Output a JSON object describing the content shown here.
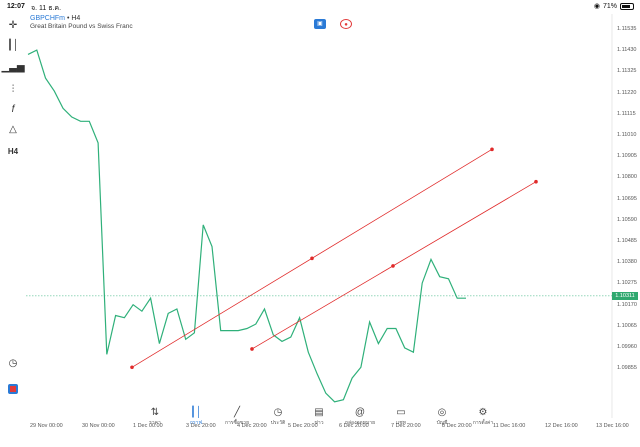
{
  "status": {
    "time": "12:07",
    "date": "จ. 11 ธ.ค.",
    "battery": "71%"
  },
  "chart": {
    "symbol": "GBPCHFm",
    "timeframe": "H4",
    "description": "Great Britain Pound vs Swiss Franc",
    "current_price": "1.10311",
    "line_color": "#2fb07a",
    "trendline_color": "#e02a2a"
  },
  "price_axis": [
    "1.11535",
    "1.11430",
    "1.11325",
    "1.11220",
    "1.11115",
    "1.11010",
    "1.10905",
    "1.10800",
    "1.10695",
    "1.10590",
    "1.10485",
    "1.10380",
    "1.10275",
    "1.10170",
    "1.10065",
    "1.09960",
    "1.09855"
  ],
  "time_axis": [
    "29 Nov 00:00",
    "30 Nov 00:00",
    "1 Dec 00:00",
    "3 Dec 20:00",
    "4 Dec 20:00",
    "5 Dec 20:00",
    "6 Dec 20:00",
    "7 Dec 20:00",
    "8 Dec 20:00",
    "11 Dec 16:00",
    "12 Dec 16:00",
    "13 Dec 16:00"
  ],
  "nav": [
    {
      "label": "ราคา",
      "icon": "quotes-icon"
    },
    {
      "label": "กราฟ",
      "icon": "chart-icon"
    },
    {
      "label": "การซื้อขาย",
      "icon": "trade-icon"
    },
    {
      "label": "ประวัติ",
      "icon": "history-icon"
    },
    {
      "label": "ข่าว",
      "icon": "news-icon"
    },
    {
      "label": "กล่องจดหมาย",
      "icon": "mailbox-icon"
    },
    {
      "label": "แชท",
      "icon": "chat-icon"
    },
    {
      "label": "บัญชี",
      "icon": "account-icon"
    },
    {
      "label": "การตั้งค่า",
      "icon": "settings-icon"
    }
  ],
  "chart_data": {
    "type": "line",
    "title": "",
    "series": [
      {
        "name": "",
        "values": [
          1.1143,
          1.1145,
          1.1132,
          1.1126,
          1.1118,
          1.1114,
          1.1112,
          1.1112,
          1.1102,
          1.1004,
          1.1022,
          1.1021,
          1.1027,
          1.1024,
          1.103,
          1.1009,
          1.1023,
          1.1025,
          1.1011,
          1.1014,
          1.1064,
          1.1054,
          1.1015,
          1.1015,
          1.1015,
          1.1016,
          1.1018,
          1.1025,
          1.1013,
          1.101,
          1.1012,
          1.1021,
          1.1005,
          1.0995,
          1.0986,
          1.0982,
          1.0983,
          1.0993,
          1.0998,
          1.1019,
          1.1009,
          1.1016,
          1.1016,
          1.1007,
          1.1005,
          1.1037,
          1.1048,
          1.104,
          1.1039,
          1.103,
          1.103
        ]
      }
    ],
    "trendlines": [
      {
        "from": {
          "time": "30 Nov 20:00",
          "price": 1.0998
        },
        "to": {
          "time": "11 Dec 00:00",
          "price": 1.1099
        }
      },
      {
        "from": {
          "time": "4 Dec 20:00",
          "price": 1.10065
        },
        "to": {
          "time": "11 Dec 16:00",
          "price": 1.1084
        }
      }
    ],
    "ylim": [
      1.0981,
      1.1158
    ],
    "current_price": 1.10311
  }
}
